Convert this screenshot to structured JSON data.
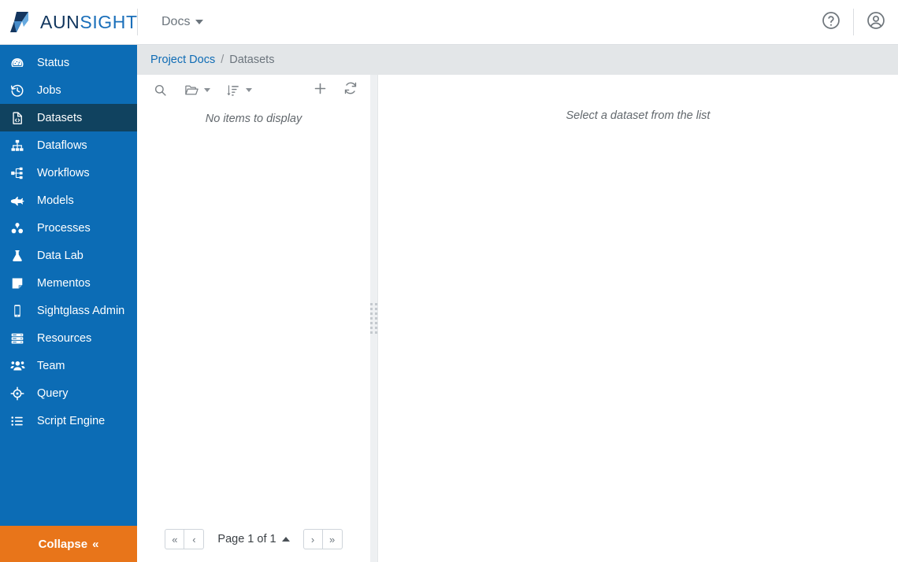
{
  "brand": {
    "part1": "AUN",
    "part2": "SIGHT",
    "icon": "aunsight-logo-mark"
  },
  "header": {
    "docs_label": "Docs",
    "docs_caret_icon": "chevron-down-icon",
    "help_icon": "help-circle-icon",
    "account_icon": "user-circle-icon"
  },
  "sidebar": {
    "items": [
      {
        "label": "Status",
        "icon": "tachometer-icon",
        "active": false
      },
      {
        "label": "Jobs",
        "icon": "history-icon",
        "active": false
      },
      {
        "label": "Datasets",
        "icon": "file-code-icon",
        "active": true
      },
      {
        "label": "Dataflows",
        "icon": "sitemap-icon",
        "active": false
      },
      {
        "label": "Workflows",
        "icon": "project-diagram-icon",
        "active": false
      },
      {
        "label": "Models",
        "icon": "jet-icon",
        "active": false
      },
      {
        "label": "Processes",
        "icon": "cubes-icon",
        "active": false
      },
      {
        "label": "Data Lab",
        "icon": "flask-icon",
        "active": false
      },
      {
        "label": "Mementos",
        "icon": "sticky-note-icon",
        "active": false
      },
      {
        "label": "Sightglass Admin",
        "icon": "tablet-icon",
        "active": false
      },
      {
        "label": "Resources",
        "icon": "server-icon",
        "active": false
      },
      {
        "label": "Team",
        "icon": "users-icon",
        "active": false
      },
      {
        "label": "Query",
        "icon": "crosshairs-icon",
        "active": false
      },
      {
        "label": "Script Engine",
        "icon": "list-icon",
        "active": false
      }
    ],
    "collapse_label": "Collapse",
    "collapse_icon": "double-chevron-left-icon",
    "accent_color": "#0c6cb5",
    "active_color": "#10425f",
    "collapse_color": "#e8751a"
  },
  "breadcrumb": {
    "root": "Project Docs",
    "separator": "/",
    "current": "Datasets"
  },
  "list_panel": {
    "toolbar": {
      "search_icon": "search-icon",
      "folder_icon": "folder-open-icon",
      "sort_icon": "sort-amount-down-icon",
      "add_icon": "plus-icon",
      "refresh_icon": "refresh-icon"
    },
    "empty_message": "No items to display",
    "pagination": {
      "first_label": "«",
      "prev_label": "‹",
      "page_label": "Page 1 of 1",
      "page_caret_icon": "caret-up-icon",
      "next_label": "›",
      "last_label": "»"
    }
  },
  "detail_panel": {
    "placeholder": "Select a dataset from the list"
  },
  "splitter": {
    "icon": "drag-grip-icon"
  }
}
